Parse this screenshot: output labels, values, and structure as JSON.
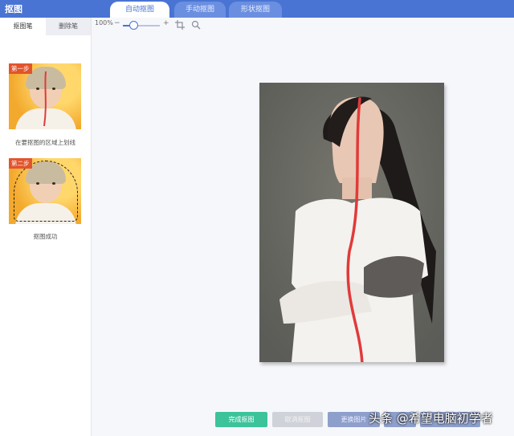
{
  "app": {
    "title": "抠图"
  },
  "tabs": [
    {
      "label": "自动抠图",
      "active": true
    },
    {
      "label": "手动抠图",
      "active": false
    },
    {
      "label": "形状抠图",
      "active": false
    }
  ],
  "left_panel": {
    "tabs": [
      {
        "label": "抠图笔",
        "active": true
      },
      {
        "label": "删除笔",
        "active": false
      }
    ],
    "steps": [
      {
        "badge": "第一步",
        "caption": "在要抠图的区域上划线"
      },
      {
        "badge": "第二步",
        "caption": "抠图成功"
      }
    ]
  },
  "toolbar": {
    "zoom": "100%",
    "minus": "−",
    "plus": "+",
    "zoom_percent": 25
  },
  "buttons": {
    "finish": "完成抠图",
    "cancel": "取消抠图",
    "replace": "更换图片"
  },
  "watermark": "头条 @希望电脑初学者",
  "colors": {
    "accent": "#4a74d3",
    "finish": "#3cc39a",
    "stroke": "#e13a3a"
  }
}
